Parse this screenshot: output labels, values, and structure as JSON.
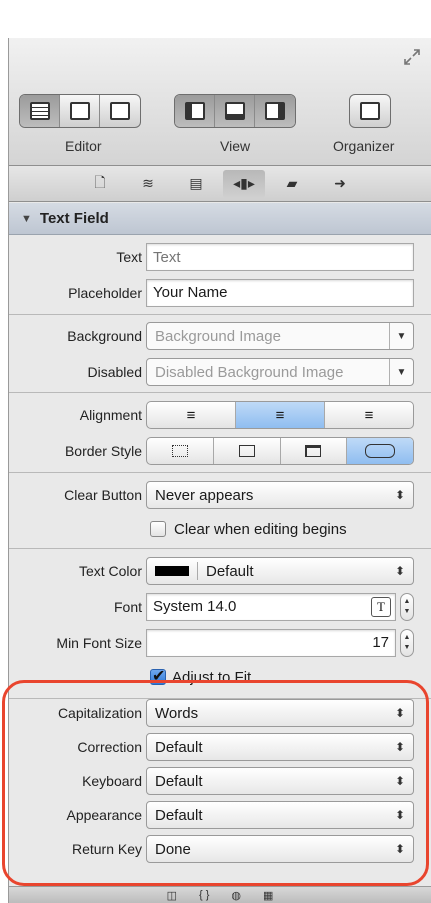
{
  "toolbar": {
    "editor_label": "Editor",
    "view_label": "View",
    "organizer_label": "Organizer"
  },
  "inspector_tabs": [
    "file-icon",
    "quick-help-icon",
    "identity-icon",
    "attributes-icon",
    "size-icon",
    "connections-icon"
  ],
  "section": {
    "title": "Text Field"
  },
  "fields": {
    "text_label": "Text",
    "text_placeholder": "Text",
    "placeholder_label": "Placeholder",
    "placeholder_value": "Your Name",
    "background_label": "Background",
    "background_placeholder": "Background Image",
    "disabled_label": "Disabled",
    "disabled_placeholder": "Disabled Background Image",
    "alignment_label": "Alignment",
    "border_style_label": "Border Style",
    "clear_button_label": "Clear Button",
    "clear_button_value": "Never appears",
    "clear_editing_label": "Clear when editing begins",
    "text_color_label": "Text Color",
    "text_color_value": "Default",
    "font_label": "Font",
    "font_value": "System 14.0",
    "min_font_label": "Min Font Size",
    "min_font_value": "17",
    "adjust_label": "Adjust to Fit",
    "capitalization_label": "Capitalization",
    "capitalization_value": "Words",
    "correction_label": "Correction",
    "correction_value": "Default",
    "keyboard_label": "Keyboard",
    "keyboard_value": "Default",
    "appearance_label": "Appearance",
    "appearance_value": "Default",
    "return_key_label": "Return Key",
    "return_key_value": "Done"
  },
  "state": {
    "alignment_selected": "center",
    "border_style_selected": "rounded",
    "clear_editing_checked": false,
    "adjust_to_fit_checked": true
  },
  "colors": {
    "highlight": "#e9452e",
    "selected_segment": "#8fbdf0",
    "text_color_swatch": "#000000"
  }
}
